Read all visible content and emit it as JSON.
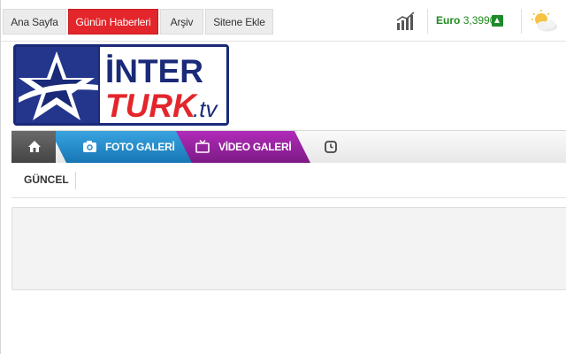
{
  "top_nav": {
    "items": [
      {
        "label": "Ana Sayfa",
        "active": false
      },
      {
        "label": "Günün Haberleri",
        "active": true
      },
      {
        "label": "Arşiv",
        "active": false
      },
      {
        "label": "Sitene Ekle",
        "active": false
      }
    ]
  },
  "finance": {
    "icon": "bar-chart-icon",
    "currency_name": "Euro",
    "currency_value": "3,3990",
    "trend": "up",
    "trend_color": "#1f8a2a"
  },
  "weather": {
    "icon": "sun-cloud-icon"
  },
  "logo": {
    "line1": "İNTER",
    "line2": "TURK",
    "suffix": ".tv",
    "brand_blue": "#1a2a78",
    "brand_red": "#e3262b"
  },
  "main_nav": {
    "home_icon": "home-icon",
    "foto": {
      "label": "FOTO GALERİ",
      "icon": "camera-icon",
      "color": "#2b8fd0"
    },
    "video": {
      "label": "VİDEO GALERİ",
      "icon": "tv-icon",
      "color": "#9b22a3"
    },
    "extra_icon": "clock-icon"
  },
  "sub_nav": {
    "items": [
      "GÜNCEL"
    ]
  },
  "colors": {
    "accent_red": "#e3262b"
  }
}
